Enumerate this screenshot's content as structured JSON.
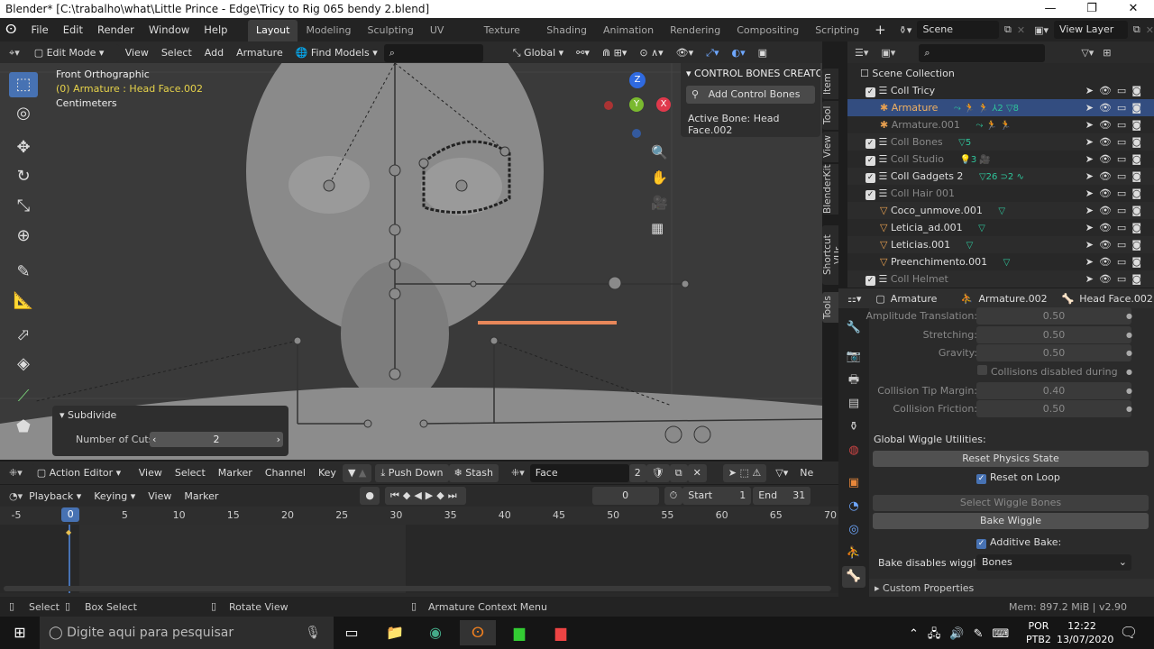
{
  "window": {
    "title": "Blender* [C:\\trabalho\\what\\Little Prince - Edge\\Tricy to Rig 065 bendy 2.blend]",
    "minimize": "—",
    "maximize": "❐",
    "close": "✕"
  },
  "topbar": {
    "menus": [
      "File",
      "Edit",
      "Render",
      "Window",
      "Help"
    ],
    "workspaces": [
      "Layout",
      "Modeling",
      "Sculpting",
      "UV Editing",
      "Texture Paint",
      "Shading",
      "Animation",
      "Rendering",
      "Compositing",
      "Scripting"
    ],
    "add_ws": "+",
    "scene": "Scene",
    "view_layer": "View Layer"
  },
  "viewport_header": {
    "mode": "Edit Mode",
    "menus": [
      "View",
      "Select",
      "Add",
      "Armature"
    ],
    "find_models": "Find Models",
    "orientation": "Global"
  },
  "viewport": {
    "view_name": "Front Orthographic",
    "object": "(0) Armature : Head Face.002",
    "units": "Centimeters",
    "gizmo": {
      "z": "Z",
      "y": "Y",
      "x": "X"
    }
  },
  "npanel": {
    "tabs": [
      "Item",
      "Tool",
      "View",
      "BlenderKit",
      "Shortcut VUr",
      "Tools"
    ],
    "panel_title": "CONTROL BONES CREATO",
    "add_button": "Add Control Bones",
    "active_bone": "Active Bone: Head Face.002"
  },
  "operator_panel": {
    "title": "Subdivide",
    "label": "Number of Cuts",
    "value": "2"
  },
  "outliner": {
    "root": "Scene Collection",
    "rows": [
      {
        "name": "Coll Tricy",
        "kind": "collection",
        "active": true
      },
      {
        "name": "Armature",
        "kind": "armature",
        "selected": true,
        "badges": "⤳ 🏃 🏃 ⅄2 ▽8"
      },
      {
        "name": "Armature.001",
        "kind": "armature",
        "dim": true,
        "badges": "⤳ 🏃 🏃"
      },
      {
        "name": "Coll Bones",
        "kind": "collection",
        "dim": true,
        "badges": "▽5"
      },
      {
        "name": "Coll Studio",
        "kind": "collection",
        "dim": true,
        "badges": "💡3 🎥"
      },
      {
        "name": "Coll Gadgets 2",
        "kind": "collection",
        "badges": "▽26 ⊃2 ∿"
      },
      {
        "name": "Coll Hair 001",
        "kind": "collection",
        "dim": true
      },
      {
        "name": "Coco_unmove.001",
        "kind": "mesh",
        "badges": "▽"
      },
      {
        "name": "Leticia_ad.001",
        "kind": "mesh",
        "badges": "▽"
      },
      {
        "name": "Leticias.001",
        "kind": "mesh",
        "badges": "▽"
      },
      {
        "name": "Preenchimento.001",
        "kind": "mesh",
        "badges": "▽"
      },
      {
        "name": "Coll Helmet",
        "kind": "collection",
        "dim": true
      }
    ]
  },
  "properties": {
    "breadcrumb": [
      "Armature",
      "Armature.002",
      "Head Face.002"
    ],
    "fields": [
      {
        "label": "Amplitude Translation:",
        "value": "0.50"
      },
      {
        "label": "Stretching:",
        "value": "0.50"
      },
      {
        "label": "Gravity:",
        "value": "0.50"
      }
    ],
    "collisions_note": "Collisions disabled during beta.",
    "fields2": [
      {
        "label": "Collision Tip Margin:",
        "value": "0.40"
      },
      {
        "label": "Collision Friction:",
        "value": "0.50"
      }
    ],
    "global_title": "Global Wiggle Utilities:",
    "reset_physics": "Reset Physics State",
    "reset_on_loop": "Reset on Loop",
    "select_wiggle": "Select Wiggle Bones",
    "bake_wiggle": "Bake Wiggle",
    "additive_bake": "Additive Bake:",
    "bake_disables_label": "Bake disables wiggle:",
    "bake_disables_value": "Bones",
    "custom_props": "Custom Properties"
  },
  "action_editor": {
    "mode": "Action Editor",
    "menus": [
      "View",
      "Select",
      "Marker",
      "Channel",
      "Key"
    ],
    "push_down": "Push Down",
    "stash": "Stash",
    "action": "Face",
    "users": "2",
    "ne": "Ne"
  },
  "timeline": {
    "menus": [
      "Playback",
      "Keying",
      "View",
      "Marker"
    ],
    "current_frame": "0",
    "start_label": "Start",
    "start": "1",
    "end_label": "End",
    "end": "31",
    "ticks": [
      "-5",
      "0",
      "5",
      "10",
      "15",
      "20",
      "25",
      "30",
      "35",
      "40",
      "45",
      "50",
      "55",
      "60",
      "65",
      "70"
    ]
  },
  "statusbar": {
    "select": "Select",
    "box_select": "Box Select",
    "rotate": "Rotate View",
    "context": "Armature Context Menu",
    "mem": "Mem: 897.2 MiB | v2.90"
  },
  "taskbar": {
    "search": "Digite aqui para pesquisar",
    "lang1": "POR",
    "lang2": "PTB2",
    "time": "12:22",
    "date": "13/07/2020"
  },
  "colors": {
    "accent": "#4772b3",
    "orange": "#e8a050",
    "green": "#2fc59b"
  }
}
